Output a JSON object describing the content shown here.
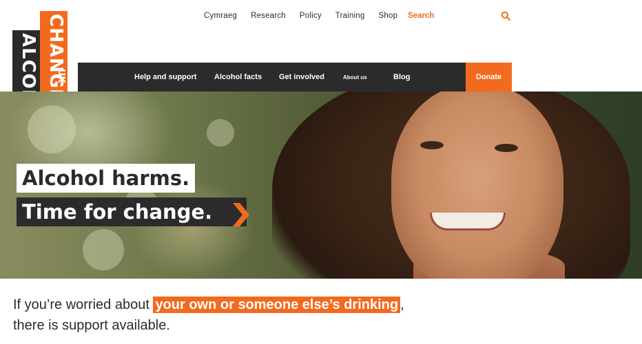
{
  "logo": {
    "word_1": "ALCOHOL",
    "word_2": "CHANGE",
    "suffix": "UK"
  },
  "utility_nav": {
    "items": [
      "Cymraeg",
      "Research",
      "Policy",
      "Training",
      "Shop"
    ],
    "search_label": "Search"
  },
  "main_nav": {
    "items": [
      "Help and support",
      "Alcohol facts",
      "Get involved",
      "About us",
      "Blog"
    ],
    "donate_label": "Donate"
  },
  "hero": {
    "headline_1": "Alcohol harms.",
    "headline_2": "Time for change."
  },
  "intro": {
    "before": "If you’re worried about ",
    "highlight": "your own or someone else’s drinking",
    "after": ",",
    "line_2": "there is support available."
  },
  "colors": {
    "accent": "#f26a1e",
    "dark": "#2b2b2b"
  }
}
